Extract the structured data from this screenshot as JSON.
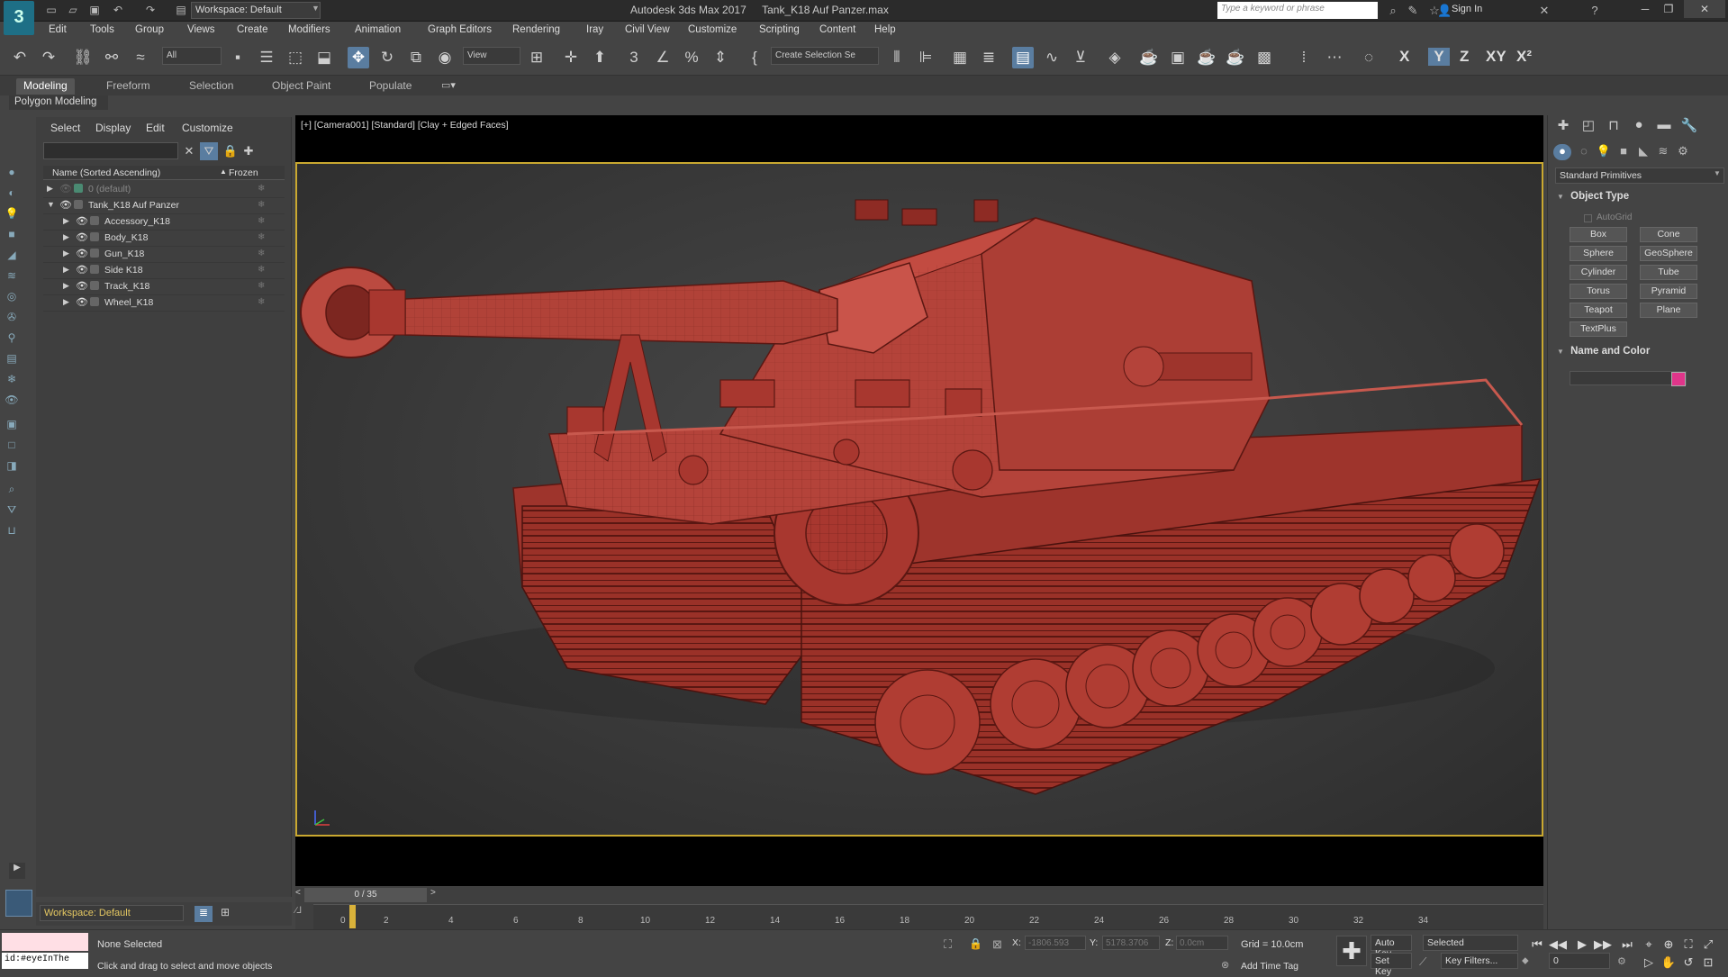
{
  "titlebar": {
    "logo": "3",
    "workspace": "Workspace: Default",
    "app_title": "Autodesk 3ds Max 2017",
    "file_title": "Tank_K18 Auf Panzer.max",
    "search_placeholder": "Type a keyword or phrase",
    "sign_in": "Sign In"
  },
  "menu": [
    "Edit",
    "Tools",
    "Group",
    "Views",
    "Create",
    "Modifiers",
    "Animation",
    "Graph Editors",
    "Rendering",
    "Iray",
    "Civil View",
    "Customize",
    "Scripting",
    "Content",
    "Help"
  ],
  "toolbar": {
    "filter_dd": "All",
    "view_dd": "View",
    "selection_set_dd": "Create Selection Se",
    "axes": [
      "X",
      "Y",
      "Z",
      "XY",
      "X²"
    ]
  },
  "ribbon": {
    "tabs": [
      "Modeling",
      "Freeform",
      "Selection",
      "Object Paint",
      "Populate"
    ],
    "active_tab": "Modeling",
    "subpanel": "Polygon Modeling"
  },
  "scene_explorer": {
    "menus": [
      "Select",
      "Display",
      "Edit",
      "Customize"
    ],
    "col_name": "Name (Sorted Ascending)",
    "col_frozen": "Frozen",
    "rows": [
      {
        "name": "0 (default)",
        "level": 0,
        "expanded": false,
        "dim": true
      },
      {
        "name": "Tank_K18 Auf Panzer",
        "level": 0,
        "expanded": true,
        "dim": false
      },
      {
        "name": "Accessory_K18",
        "level": 1,
        "expanded": false,
        "dim": false
      },
      {
        "name": "Body_K18",
        "level": 1,
        "expanded": false,
        "dim": false
      },
      {
        "name": "Gun_K18",
        "level": 1,
        "expanded": false,
        "dim": false
      },
      {
        "name": "Side K18",
        "level": 1,
        "expanded": false,
        "dim": false
      },
      {
        "name": "Track_K18",
        "level": 1,
        "expanded": false,
        "dim": false
      },
      {
        "name": "Wheel_K18",
        "level": 1,
        "expanded": false,
        "dim": false
      }
    ],
    "workspace": "Workspace: Default"
  },
  "viewport": {
    "label": "[+] [Camera001] [Standard] [Clay + Edged Faces]",
    "model_color": "#a8372f"
  },
  "timeline": {
    "slider": "0 / 35",
    "ticks": [
      "0",
      "2",
      "4",
      "6",
      "8",
      "10",
      "12",
      "14",
      "16",
      "18",
      "20",
      "22",
      "24",
      "26",
      "28",
      "30",
      "32",
      "34"
    ]
  },
  "command_panel": {
    "category": "Standard Primitives",
    "object_type_title": "Object Type",
    "autogrid": "AutoGrid",
    "primitives": [
      "Box",
      "Cone",
      "Sphere",
      "GeoSphere",
      "Cylinder",
      "Tube",
      "Torus",
      "Pyramid",
      "Teapot",
      "Plane",
      "TextPlus"
    ],
    "name_color_title": "Name and Color",
    "swatch_color": "#e0358a"
  },
  "status": {
    "listener": "id:#eyeInThe",
    "selection": "None Selected",
    "prompt": "Click and drag to select and move objects",
    "x_label": "X:",
    "x_value": "-1806.593",
    "y_label": "Y:",
    "y_value": "5178.3706",
    "z_label": "Z:",
    "z_value": "0.0cm",
    "grid": "Grid = 10.0cm",
    "add_time_tag": "Add Time Tag",
    "auto_key": "Auto Key",
    "set_key": "Set Key",
    "selected_dd": "Selected",
    "key_filters": "Key Filters...",
    "frame": "0"
  }
}
